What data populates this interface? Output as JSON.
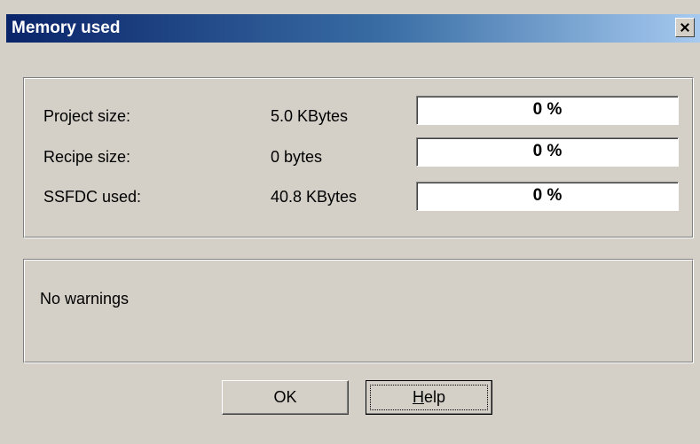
{
  "window": {
    "title": "Memory used",
    "close_glyph": "close-icon"
  },
  "memory": {
    "rows": [
      {
        "label": "Project size:",
        "value": "5.0 KBytes",
        "percent_text": "0 %",
        "percent": 0
      },
      {
        "label": "Recipe size:",
        "value": "0 bytes",
        "percent_text": "0 %",
        "percent": 0
      },
      {
        "label": "SSFDC used:",
        "value": "40.8 KBytes",
        "percent_text": "0 %",
        "percent": 0
      }
    ]
  },
  "warnings": {
    "text": "No warnings"
  },
  "buttons": {
    "ok_label": "OK",
    "help_first": "H",
    "help_rest": "elp"
  },
  "colors": {
    "dialog_bg": "#d4d0c8",
    "titlebar_start": "#0a246a",
    "titlebar_end": "#a6caf0",
    "bar_bg": "#ffffff"
  }
}
